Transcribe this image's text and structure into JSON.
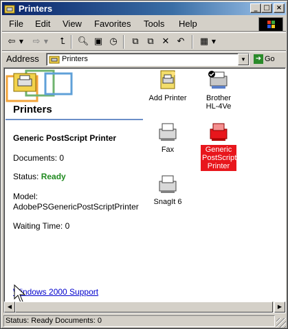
{
  "window": {
    "title": "Printers"
  },
  "menu": [
    "File",
    "Edit",
    "View",
    "Favorites",
    "Tools",
    "Help"
  ],
  "address": {
    "label": "Address",
    "value": "Printers",
    "go_label": "Go"
  },
  "left_pane": {
    "title": "Printers",
    "selected_printer": "Generic PostScript Printer",
    "documents_label": "Documents:",
    "documents_value": "0",
    "status_label": "Status:",
    "status_value": "Ready",
    "model_label": "Model:",
    "model_value": "AdobePSGenericPostScriptPrinter",
    "waiting_label": "Waiting Time:",
    "waiting_value": "0",
    "support_link": "Windows 2000 Support"
  },
  "icons": [
    {
      "label": "Add Printer"
    },
    {
      "label": "Brother HL-4Ve"
    },
    {
      "label": "Fax"
    },
    {
      "label": "Generic PostScript Printer",
      "selected": true
    },
    {
      "label": "SnagIt 6"
    }
  ],
  "statusbar": {
    "text": "Status: Ready Documents: 0"
  },
  "colors": {
    "title_start": "#0a246a",
    "selection": "#e8161c",
    "ready": "#1f8a1f",
    "link": "#0000cc"
  }
}
